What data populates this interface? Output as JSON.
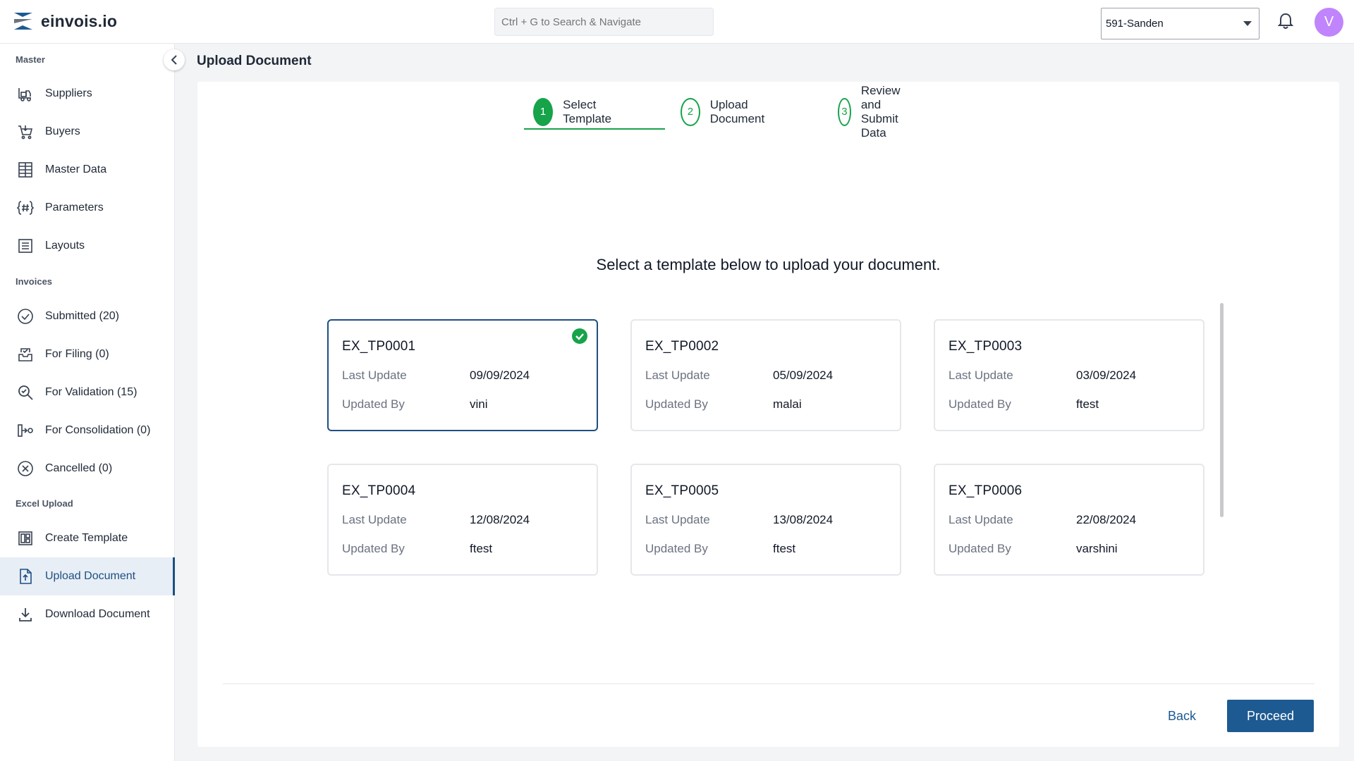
{
  "app": {
    "name": "einvois.io"
  },
  "search": {
    "placeholder": "Ctrl + G to Search & Navigate"
  },
  "company": {
    "selected": "591-Sanden"
  },
  "user": {
    "initial": "V"
  },
  "sidebar": {
    "sections": {
      "master": "Master",
      "invoices": "Invoices",
      "excel": "Excel Upload"
    },
    "items": [
      {
        "label": "Suppliers",
        "icon": "forklift-icon"
      },
      {
        "label": "Buyers",
        "icon": "cart-icon"
      },
      {
        "label": "Master Data",
        "icon": "grid-doc-icon"
      },
      {
        "label": "Parameters",
        "icon": "hash-braces-icon"
      },
      {
        "label": "Layouts",
        "icon": "list-doc-icon"
      },
      {
        "label": "Submitted (20)",
        "icon": "check-circle-icon"
      },
      {
        "label": "For Filing (0)",
        "icon": "inbox-icon"
      },
      {
        "label": "For Validation (15)",
        "icon": "search-check-icon"
      },
      {
        "label": "For Consolidation (0)",
        "icon": "merge-icon"
      },
      {
        "label": "Cancelled (0)",
        "icon": "x-circle-icon"
      },
      {
        "label": "Create Template",
        "icon": "template-icon"
      },
      {
        "label": "Upload Document",
        "icon": "upload-doc-icon",
        "active": true
      },
      {
        "label": "Download Document",
        "icon": "download-icon"
      }
    ]
  },
  "main": {
    "title": "Upload Document",
    "steps": [
      {
        "number": "1",
        "label": "Select Template",
        "active": true
      },
      {
        "number": "2",
        "label": "Upload Document"
      },
      {
        "number": "3",
        "label": "Review and Submit Data"
      }
    ],
    "instruction": "Select a template below to upload your document.",
    "field_labels": {
      "last_update": "Last Update",
      "updated_by": "Updated By"
    },
    "templates": [
      {
        "name": "EX_TP0001",
        "last_update": "09/09/2024",
        "updated_by": "vini",
        "selected": true
      },
      {
        "name": "EX_TP0002",
        "last_update": "05/09/2024",
        "updated_by": "malai"
      },
      {
        "name": "EX_TP0003",
        "last_update": "03/09/2024",
        "updated_by": "ftest"
      },
      {
        "name": "EX_TP0004",
        "last_update": "12/08/2024",
        "updated_by": "ftest"
      },
      {
        "name": "EX_TP0005",
        "last_update": "13/08/2024",
        "updated_by": "ftest"
      },
      {
        "name": "EX_TP0006",
        "last_update": "22/08/2024",
        "updated_by": "varshini"
      }
    ],
    "back_label": "Back",
    "proceed_label": "Proceed"
  },
  "colors": {
    "accent": "#1e5a92",
    "success": "#16a34a",
    "avatar": "#c084fc"
  }
}
